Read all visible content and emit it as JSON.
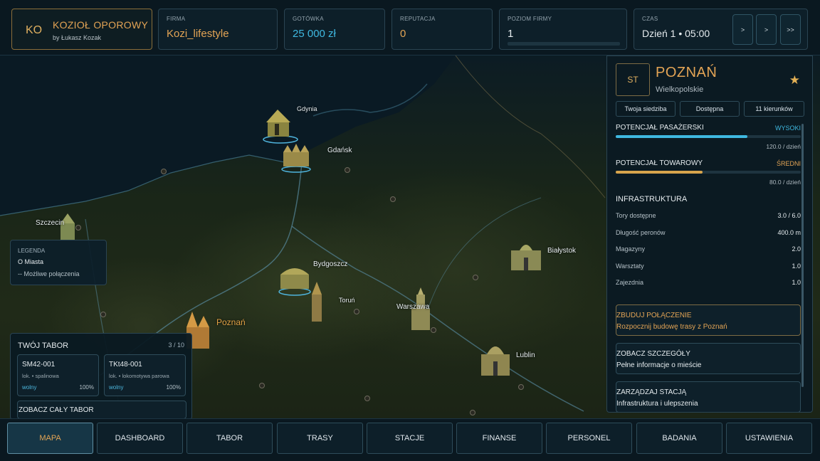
{
  "header": {
    "logo_initials": "KO",
    "company_title": "KOZIOŁ OPOROWY",
    "author": "by Łukasz Kozak",
    "firm_label": "FIRMA",
    "firm_value": "Kozi_lifestyle",
    "cash_label": "GOTÓWKA",
    "cash_value": "25 000 zł",
    "reputation_label": "REPUTACJA",
    "reputation_value": "0",
    "level_label": "POZIOM FIRMY",
    "level_value": "1",
    "time_label": "CZAS",
    "time_value": "Dzień 1 • 05:00",
    "speed_buttons": [
      ">",
      ">",
      ">>"
    ]
  },
  "map": {
    "cities": [
      {
        "name": "Gdynia"
      },
      {
        "name": "Gdańsk"
      },
      {
        "name": "Szczecin"
      },
      {
        "name": "Bydgoszcz"
      },
      {
        "name": "Toruń"
      },
      {
        "name": "Białystok"
      },
      {
        "name": "Warszawa"
      },
      {
        "name": "Poznań"
      },
      {
        "name": "Lublin"
      }
    ],
    "legend": {
      "title": "LEGENDA",
      "cities": "O Miasta",
      "connections": "-- Możliwe połączenia"
    }
  },
  "fleet": {
    "title": "TWÓJ TABOR",
    "count": "3 / 10",
    "vehicles": [
      {
        "id": "SM42-001",
        "type": "lok. • spalinowa",
        "status": "wolny",
        "condition": "100%"
      },
      {
        "id": "TKt48-001",
        "type": "lok. • lokomotywa parowa",
        "status": "wolny",
        "condition": "100%"
      }
    ],
    "view_all": "ZOBACZ CAŁY TABOR"
  },
  "city_panel": {
    "badge": "ST",
    "name": "POZNAŃ",
    "region": "Wielkopolskie",
    "tags": [
      "Twoja siedziba",
      "Dostępna",
      "11 kierunków"
    ],
    "passenger": {
      "label": "POTENCJAŁ PASAŻERSKI",
      "rating": "WYSOKI",
      "value": "120.0 / dzień",
      "fill": 0.71
    },
    "cargo": {
      "label": "POTENCJAŁ TOWAROWY",
      "rating": "ŚREDNI",
      "value": "80.0 / dzień",
      "fill": 0.47
    },
    "infra_title": "INFRASTRUKTURA",
    "infra": [
      {
        "label": "Tory dostępne",
        "value": "3.0 / 6.0"
      },
      {
        "label": "Długość peronów",
        "value": "400.0 m"
      },
      {
        "label": "Magazyny",
        "value": "2.0"
      },
      {
        "label": "Warsztaty",
        "value": "1.0"
      },
      {
        "label": "Zajezdnia",
        "value": "1.0"
      }
    ],
    "actions": [
      {
        "title": "ZBUDUJ POŁĄCZENIE",
        "subtitle": "Rozpocznij budowę trasy z Poznań"
      },
      {
        "title": "ZOBACZ SZCZEGÓŁY",
        "subtitle": "Pełne informacje o mieście"
      },
      {
        "title": "ZARZĄDZAJ STACJĄ",
        "subtitle": "Infrastruktura i ulepszenia"
      }
    ]
  },
  "nav": [
    "MAPA",
    "DASHBOARD",
    "TABOR",
    "TRASY",
    "STACJE",
    "FINANSE",
    "PERSONEL",
    "BADANIA",
    "USTAWIENIA"
  ],
  "colors": {
    "accent_gold": "#e3a455",
    "accent_blue": "#3fb8e0",
    "background": "#07141c"
  }
}
